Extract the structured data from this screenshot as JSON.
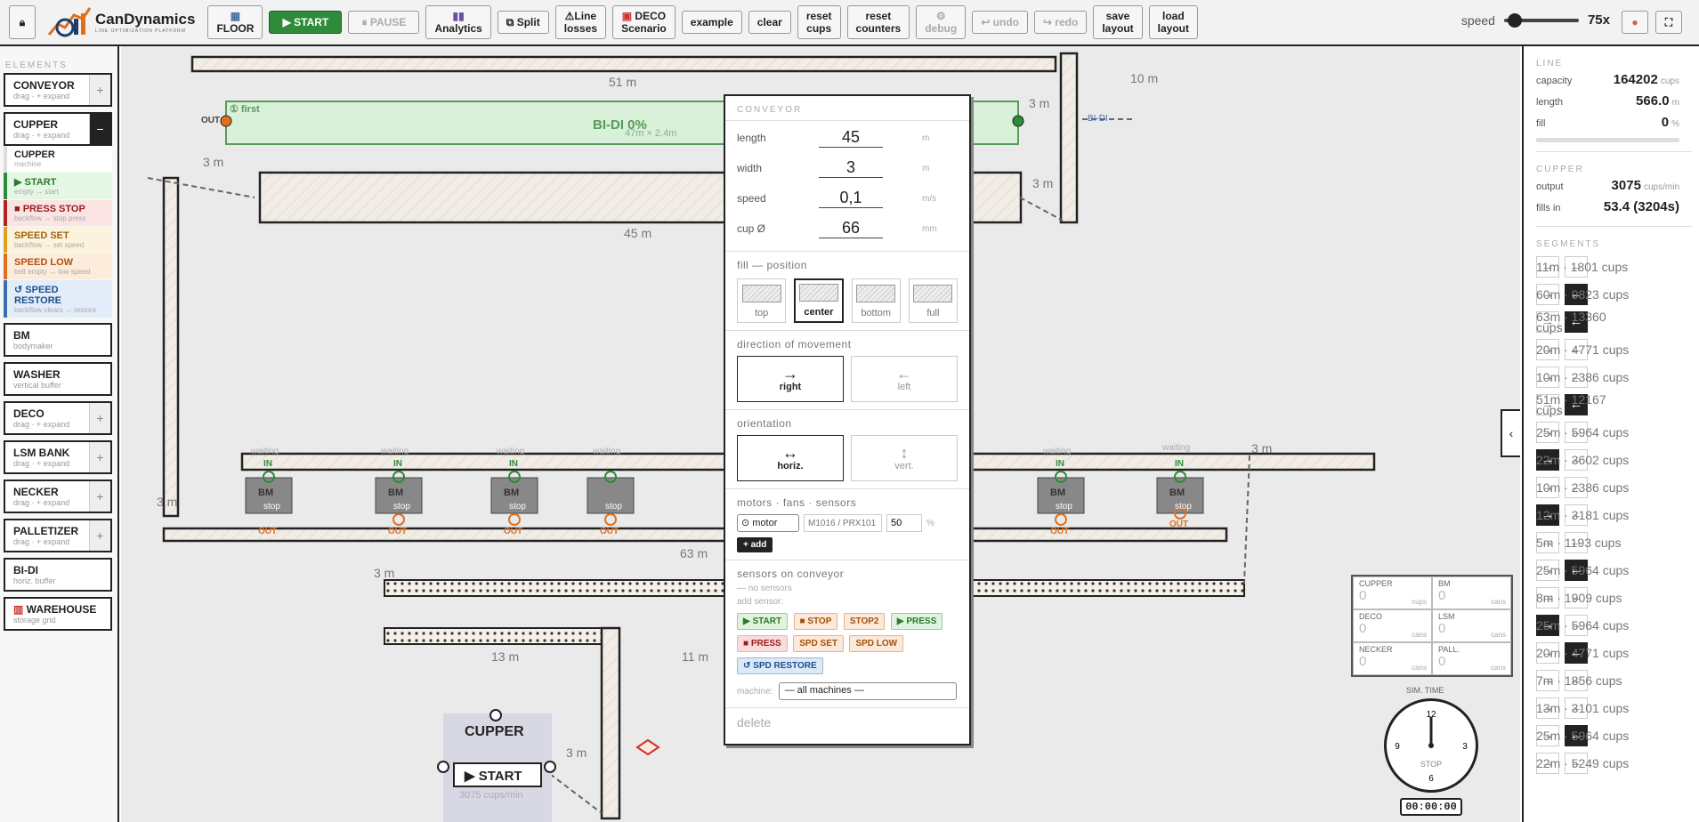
{
  "toolbar": {
    "lock_icon": "lock-icon",
    "brand": "CanDynamics",
    "brand_sub": "LINE OPTIMIZATION PLATFORM",
    "floor": "FLOOR",
    "start": "▶ START",
    "pause": "⏸ PAUSE",
    "analytics": "Analytics",
    "split": "Split",
    "line_losses_1": "Line",
    "line_losses_2": "losses",
    "deco_1": "DECO",
    "deco_2": "Scenario",
    "example": "example",
    "clear": "clear",
    "reset_cups_1": "reset",
    "reset_cups_2": "cups",
    "reset_counters_1": "reset",
    "reset_counters_2": "counters",
    "debug": "debug",
    "undo": "↩ undo",
    "redo": "↪ redo",
    "save_1": "save",
    "save_2": "layout",
    "load_1": "load",
    "load_2": "layout",
    "speed_label": "speed",
    "speed_value": "75x",
    "speed_fraction": 0.05
  },
  "left": {
    "title": "ELEMENTS",
    "conveyor": {
      "t": "CONVEYOR",
      "s": "drag · + expand"
    },
    "cupper": {
      "t": "CUPPER",
      "s": "drag · + expand"
    },
    "cupper_sub": {
      "t": "CUPPER",
      "s": "machine"
    },
    "start": {
      "t": "▶ START",
      "s": "empty → start"
    },
    "press_stop": {
      "t": "■ PRESS STOP",
      "s": "backflow → stop press"
    },
    "speed_set": {
      "t": "SPEED SET",
      "s": "backflow → set speed"
    },
    "speed_low": {
      "t": "SPEED LOW",
      "s": "belt empty → low speed"
    },
    "speed_restore": {
      "t": "↺ SPEED RESTORE",
      "s": "backflow clears → restore"
    },
    "bm": {
      "t": "BM",
      "s": "bodymaker"
    },
    "washer": {
      "t": "WASHER",
      "s": "vertical buffer"
    },
    "deco": {
      "t": "DECO",
      "s": "drag · + expand"
    },
    "lsm": {
      "t": "LSM BANK",
      "s": "drag · + expand"
    },
    "necker": {
      "t": "NECKER",
      "s": "drag · + expand"
    },
    "palletizer": {
      "t": "PALLETIZER",
      "s": "drag · + expand"
    },
    "bidi": {
      "t": "BI-DI",
      "s": "horiz. buffer"
    },
    "warehouse": {
      "t": "WAREHOUSE",
      "s": "storage grid"
    }
  },
  "popup": {
    "title": "CONVEYOR",
    "fields": [
      {
        "k": "length",
        "v": "45",
        "u": "m"
      },
      {
        "k": "width",
        "v": "3",
        "u": "m"
      },
      {
        "k": "speed",
        "v": "0,1",
        "u": "m/s"
      },
      {
        "k": "cup Ø",
        "v": "66",
        "u": "mm"
      }
    ],
    "fill_title": "fill — position",
    "fill": [
      "top",
      "center",
      "bottom",
      "full"
    ],
    "dir_title": "direction of movement",
    "dir_right": "right",
    "dir_left": "left",
    "orient_title": "orientation",
    "orient_h": "horiz.",
    "orient_v": "vert.",
    "motors_title": "motors · fans · sensors",
    "motor_select": "⊙ motor",
    "motor_placeholder": "M1016 / PRX101",
    "motor_pct": "50",
    "motor_pct_unit": "%",
    "add": "+ add",
    "sensors_title": "sensors on conveyor",
    "no_sensors": "— no sensors",
    "add_sensor": "add sensor:",
    "chips": [
      "▶ START",
      "■ STOP",
      "STOP2",
      "▶ PRESS",
      "■ PRESS",
      "SPD SET",
      "SPD LOW",
      "↺ SPD RESTORE"
    ],
    "machine_label": "machine:",
    "machine_value": "— all machines —",
    "delete": "delete"
  },
  "right": {
    "line_title": "LINE",
    "capacity_k": "capacity",
    "capacity_v": "164202",
    "capacity_u": "cups",
    "length_k": "length",
    "length_v": "566.0",
    "length_u": "m",
    "fill_k": "fill",
    "fill_v": "0",
    "fill_u": "%",
    "cupper_title": "CUPPER",
    "output_k": "output",
    "output_v": "3075",
    "output_u": "cups/min",
    "fillsin_k": "fills in",
    "fillsin_v": "53.4 (3204s)",
    "segments_title": "SEGMENTS",
    "segments": [
      {
        "l": "11m · 1801 cups",
        "dir": "none"
      },
      {
        "l": "60m · 9823 cups",
        "dir": "left"
      },
      {
        "l": "63m · 13360 cups",
        "dir": "left"
      },
      {
        "l": "20m · 4771 cups",
        "dir": "none"
      },
      {
        "l": "10m · 2386 cups",
        "dir": "none"
      },
      {
        "l": "51m · 12167 cups",
        "dir": "left"
      },
      {
        "l": "25m · 5964 cups",
        "dir": "none"
      },
      {
        "l": "22m · 3602 cups",
        "dir": "right"
      },
      {
        "l": "10m · 2386 cups",
        "dir": "none"
      },
      {
        "l": "12m · 3181 cups",
        "dir": "right"
      },
      {
        "l": "5m · 1193 cups",
        "dir": "none"
      },
      {
        "l": "25m · 5964 cups",
        "dir": "left"
      },
      {
        "l": "8m · 1909 cups",
        "dir": "none"
      },
      {
        "l": "25m · 5964 cups",
        "dir": "right"
      },
      {
        "l": "20m · 4771 cups",
        "dir": "left"
      },
      {
        "l": "7m · 1856 cups",
        "dir": "none"
      },
      {
        "l": "13m · 3101 cups",
        "dir": "none"
      },
      {
        "l": "25m · 5964 cups",
        "dir": "left"
      },
      {
        "l": "22m · 5249 cups",
        "dir": "none"
      }
    ]
  },
  "counters": [
    {
      "k": "CUPPER",
      "v": "0",
      "u": "cups"
    },
    {
      "k": "BM",
      "v": "0",
      "u": "cans"
    },
    {
      "k": "DECO",
      "v": "0",
      "u": "cans"
    },
    {
      "k": "LSM",
      "v": "0",
      "u": "cans"
    },
    {
      "k": "NECKER",
      "v": "0",
      "u": "cans"
    },
    {
      "k": "PALL.",
      "v": "0",
      "u": "cans"
    }
  ],
  "sim": {
    "label": "SIM. TIME",
    "state": "STOP",
    "time": "00:00:00"
  },
  "canvas": {
    "lbl_51m": "51 m",
    "lbl_10m": "10 m",
    "lbl_3m": "3 m",
    "lbl_45m": "45 m",
    "lbl_63m": "63 m",
    "lbl_13m": "13 m",
    "lbl_11m": "11 m",
    "bidi": "BI-DI 0%",
    "bidi_dims": "47m × 2.4m",
    "bidi_tag": "BI-DI",
    "first": "① first",
    "out": "OUT",
    "in": "IN",
    "waiting": "waiting",
    "bm": "BM",
    "stop": "stop",
    "cupper": "CUPPER",
    "cupper_start": "▶ START",
    "cupper_rate": "3075 cups/min"
  }
}
